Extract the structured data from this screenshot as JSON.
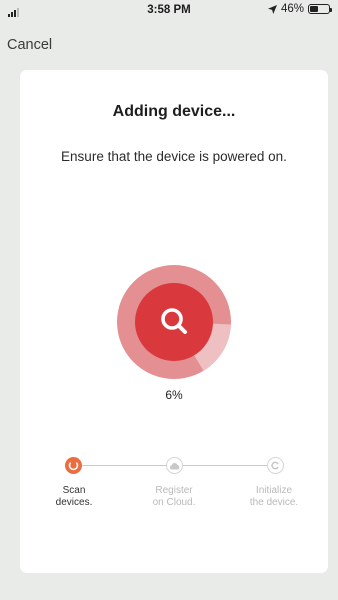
{
  "status_bar": {
    "time": "3:58 PM",
    "battery_percent": "46%",
    "battery_level": 0.46
  },
  "nav": {
    "cancel_label": "Cancel"
  },
  "card": {
    "title": "Adding device...",
    "subtitle": "Ensure that the device is powered on.",
    "progress_label": "6%",
    "progress_value": 6,
    "steps": [
      {
        "line1": "Scan",
        "line2": "devices.",
        "state": "active"
      },
      {
        "line1": "Register",
        "line2": "on Cloud.",
        "state": "pending"
      },
      {
        "line1": "Initialize",
        "line2": "the device.",
        "state": "pending"
      }
    ]
  },
  "colors": {
    "accent": "#ec6d3f",
    "spinner_core": "#d9383d",
    "spinner_ring": "#e48f92",
    "card": "#ffffff",
    "background": "#e9ebe9"
  }
}
